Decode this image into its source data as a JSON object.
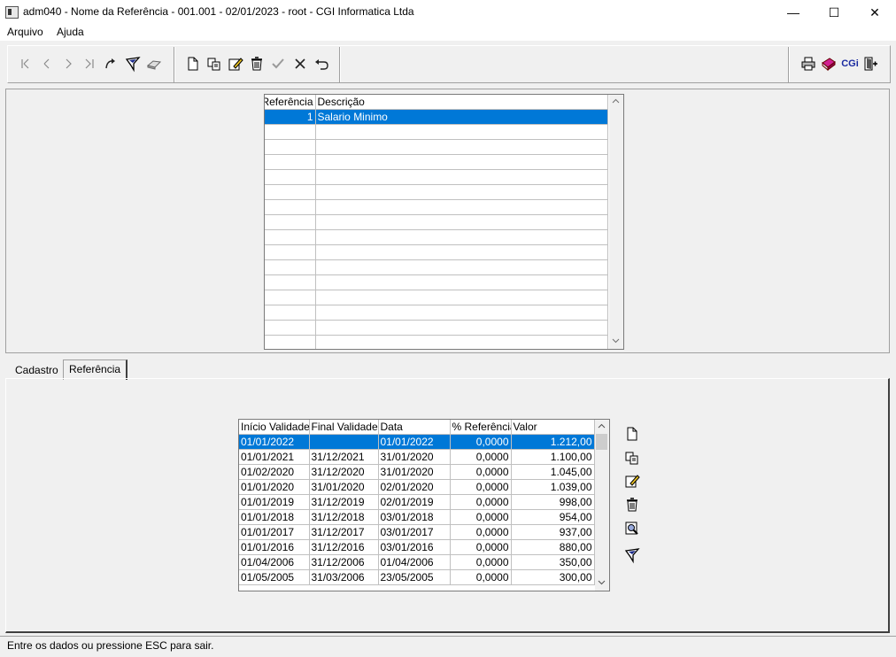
{
  "window": {
    "title": "adm040 - Nome da Referência - 001.001 - 02/01/2023 - root - CGI Informatica Ltda",
    "minimize": "—",
    "maximize": "☐",
    "close": "✕"
  },
  "menu": {
    "items": [
      "Arquivo",
      "Ajuda"
    ]
  },
  "toolbar": {
    "nav_icons": [
      "first-icon",
      "previous-icon",
      "next-icon",
      "last-icon",
      "refresh-icon",
      "filter-icon",
      "find-icon"
    ],
    "edit_icons": [
      "new-icon",
      "copy-icon",
      "edit-icon",
      "delete-icon",
      "confirm-icon",
      "cancel-icon",
      "undo-icon"
    ],
    "right_icons": [
      "print-icon",
      "book-icon",
      "cgi-logo-icon",
      "exit-icon"
    ],
    "cgi_label": "CGi"
  },
  "ref_grid": {
    "columns": [
      "Referência",
      "Descrição"
    ],
    "rows": [
      [
        "1",
        "Salario Minimo"
      ]
    ]
  },
  "tabs": {
    "items": [
      "Cadastro",
      "Referência"
    ],
    "active": "Referência"
  },
  "values_grid": {
    "columns": [
      "Início Validade",
      "Final Validade",
      "Data",
      "% Referência",
      "Valor"
    ],
    "rows": [
      [
        "01/01/2022",
        "",
        "01/01/2022",
        "0,0000",
        "1.212,00"
      ],
      [
        "01/01/2021",
        "31/12/2021",
        "31/01/2020",
        "0,0000",
        "1.100,00"
      ],
      [
        "01/02/2020",
        "31/12/2020",
        "31/01/2020",
        "0,0000",
        "1.045,00"
      ],
      [
        "01/01/2020",
        "31/01/2020",
        "02/01/2020",
        "0,0000",
        "1.039,00"
      ],
      [
        "01/01/2019",
        "31/12/2019",
        "02/01/2019",
        "0,0000",
        "998,00"
      ],
      [
        "01/01/2018",
        "31/12/2018",
        "03/01/2018",
        "0,0000",
        "954,00"
      ],
      [
        "01/01/2017",
        "31/12/2017",
        "03/01/2017",
        "0,0000",
        "937,00"
      ],
      [
        "01/01/2016",
        "31/12/2016",
        "03/01/2016",
        "0,0000",
        "880,00"
      ],
      [
        "01/04/2006",
        "31/12/2006",
        "01/04/2006",
        "0,0000",
        "350,00"
      ],
      [
        "01/05/2005",
        "31/03/2006",
        "23/05/2005",
        "0,0000",
        "300,00"
      ]
    ]
  },
  "side_buttons": [
    "new-icon",
    "copy-icon",
    "edit-icon",
    "delete-icon",
    "search-icon",
    "filter-icon"
  ],
  "status": {
    "text": "Entre os dados ou pressione ESC para sair."
  },
  "colors": {
    "selection": "#0078d7",
    "background": "#f0f0f0"
  }
}
